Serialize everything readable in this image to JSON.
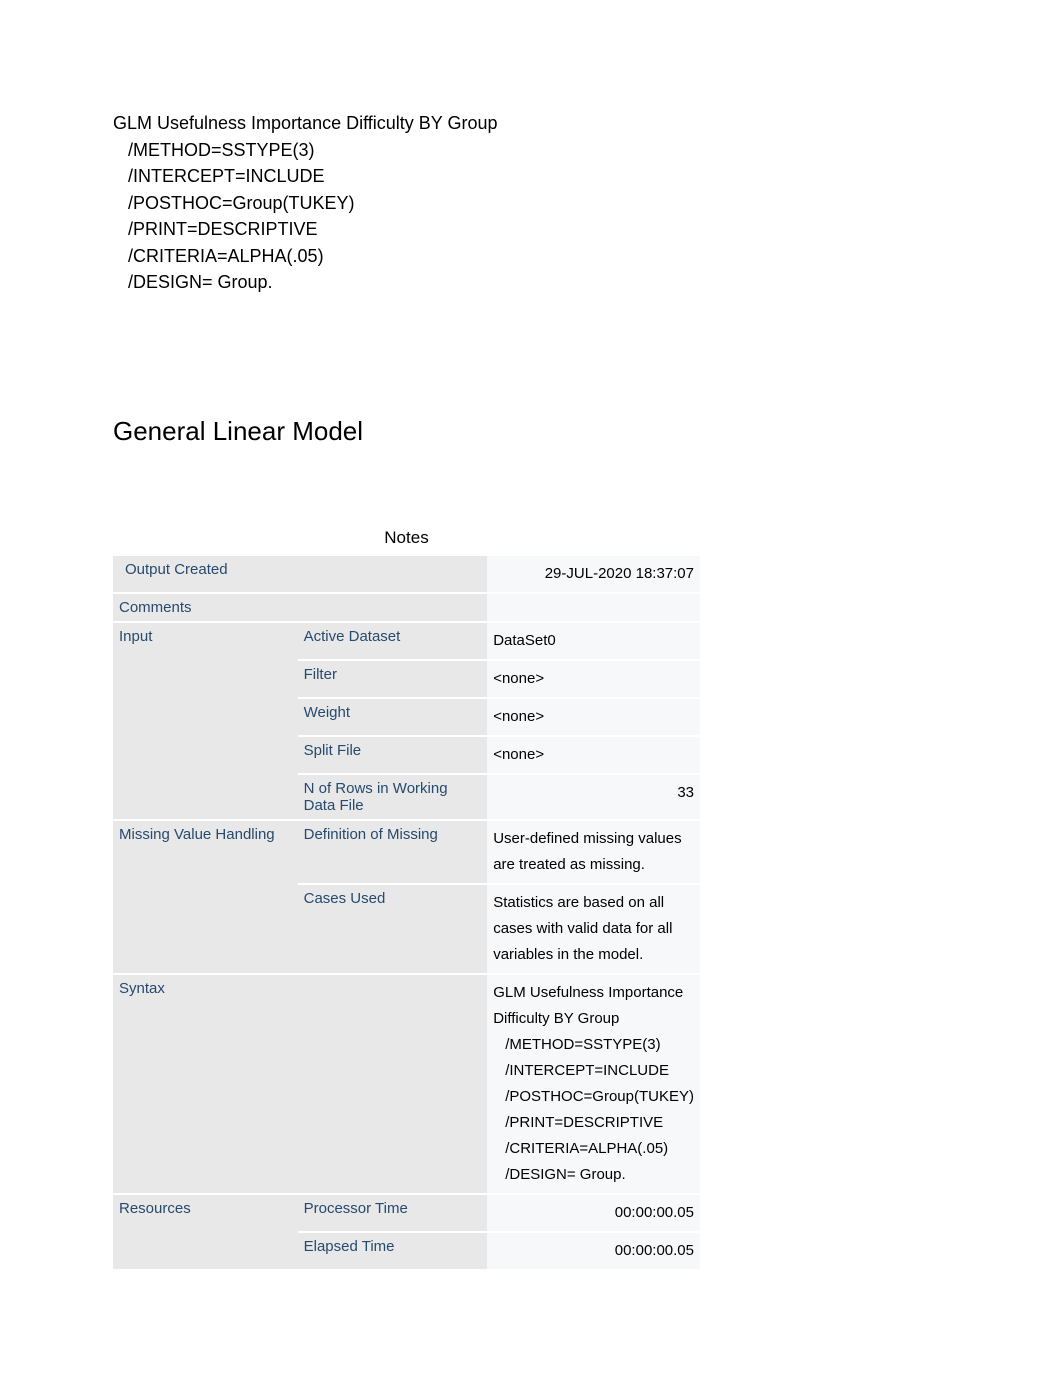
{
  "syntax_block": "GLM Usefulness Importance Difficulty BY Group\n   /METHOD=SSTYPE(3)\n   /INTERCEPT=INCLUDE\n   /POSTHOC=Group(TUKEY)\n   /PRINT=DESCRIPTIVE\n   /CRITERIA=ALPHA(.05)\n   /DESIGN= Group.",
  "heading": "General Linear Model",
  "notes_title": "Notes",
  "rows": {
    "output_created": {
      "label": "Output Created",
      "value": "29-JUL-2020 18:37:07"
    },
    "comments": {
      "label": "Comments",
      "value": ""
    },
    "input": {
      "label": "Input",
      "active_dataset": {
        "label": "Active Dataset",
        "value": "DataSet0"
      },
      "filter": {
        "label": "Filter",
        "value": "<none>"
      },
      "weight": {
        "label": "Weight",
        "value": "<none>"
      },
      "split_file": {
        "label": "Split File",
        "value": "<none>"
      },
      "n_rows": {
        "label": "N of Rows in Working Data File",
        "value": "33"
      }
    },
    "missing": {
      "label": "Missing Value Handling",
      "definition": {
        "label": "Definition of Missing",
        "value": "User-defined missing values are treated as missing."
      },
      "cases_used": {
        "label": "Cases Used",
        "value": "Statistics are based on all cases with valid data for all variables in the model."
      }
    },
    "syntax": {
      "label": "Syntax",
      "value_lines": [
        "GLM Usefulness Importance Difficulty BY Group",
        "   /METHOD=SSTYPE(3)",
        "   /INTERCEPT=INCLUDE",
        "   /POSTHOC=Group(TUKEY)",
        "   /PRINT=DESCRIPTIVE",
        "   /CRITERIA=ALPHA(.05)",
        "   /DESIGN= Group."
      ]
    },
    "resources": {
      "label": "Resources",
      "processor_time": {
        "label": "Processor Time",
        "value": "00:00:00.05"
      },
      "elapsed_time": {
        "label": "Elapsed Time",
        "value": "00:00:00.05"
      }
    }
  }
}
